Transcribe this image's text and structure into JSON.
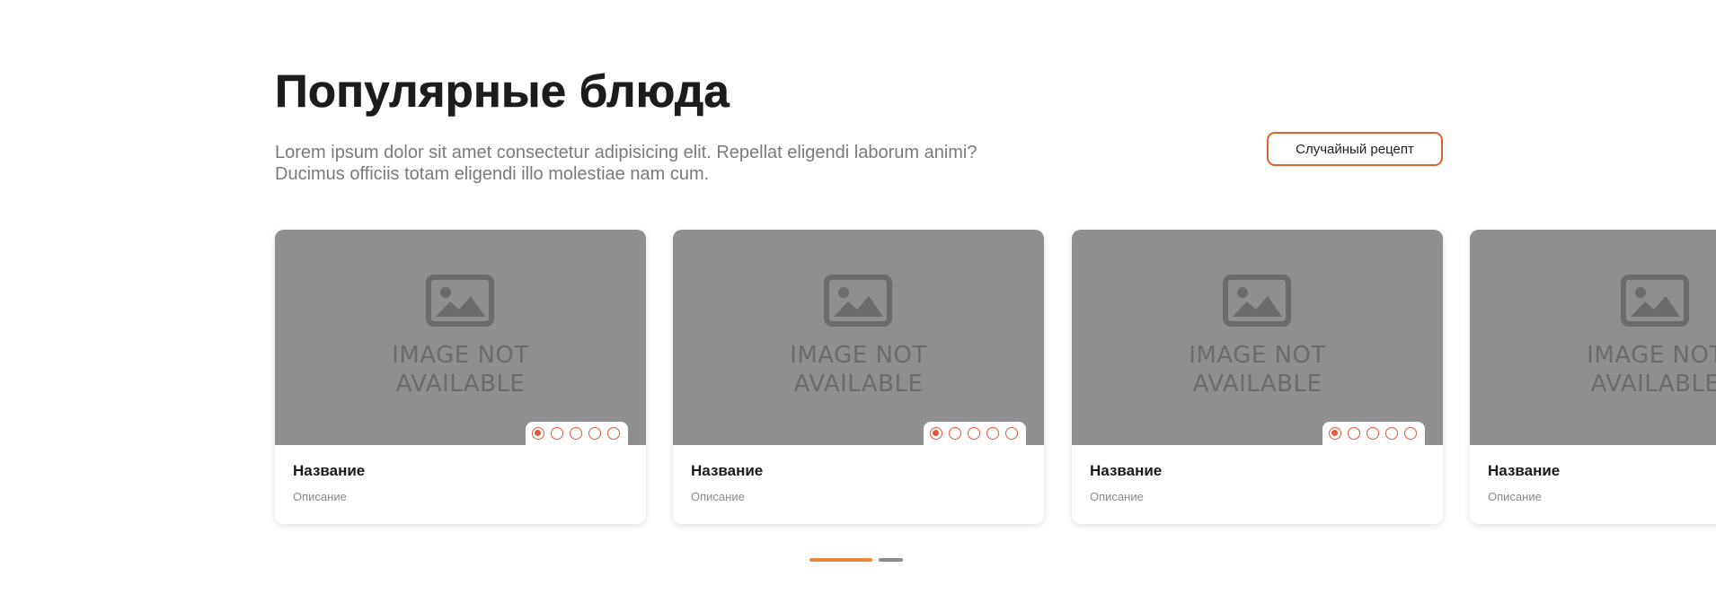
{
  "header": {
    "title": "Популярные блюда",
    "subtitle": "Lorem ipsum dolor sit amet consectetur adipisicing elit. Repellat eligendi laborum animi? Ducimus officiis totam eligendi illo molestiae nam cum.",
    "random_button_label": "Случайный рецепт"
  },
  "cards": [
    {
      "name": "Название",
      "description": "Описание",
      "image_placeholder": "IMAGE NOT AVAILABLE",
      "rating": 1,
      "rating_max": 5
    },
    {
      "name": "Название",
      "description": "Описание",
      "image_placeholder": "IMAGE NOT AVAILABLE",
      "rating": 1,
      "rating_max": 5
    },
    {
      "name": "Название",
      "description": "Описание",
      "image_placeholder": "IMAGE NOT AVAILABLE",
      "rating": 1,
      "rating_max": 5
    },
    {
      "name": "Название",
      "description": "Описание",
      "image_placeholder": "IMAGE NOT AVAILABLE",
      "rating": 1,
      "rating_max": 5
    }
  ],
  "pagination": {
    "page_count": 2,
    "active_page": 1
  },
  "colors": {
    "accent": "#e2622f",
    "star": "#e25a3a",
    "pager_active": "#e98a3a",
    "pager_inactive": "#8a8a8a",
    "image_bg": "#8f8f8f"
  },
  "icons": {
    "image_placeholder": "image-icon",
    "rating": "circle-star-icon"
  }
}
